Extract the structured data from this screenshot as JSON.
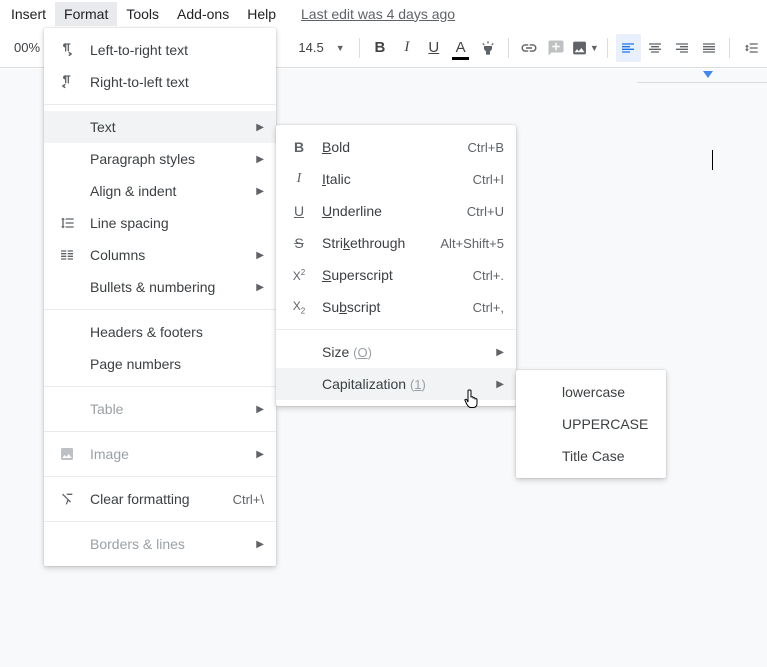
{
  "menubar": {
    "items": [
      "Insert",
      "Format",
      "Tools",
      "Add-ons",
      "Help"
    ],
    "active_index": 1,
    "last_edit": "Last edit was 4 days ago"
  },
  "toolbar": {
    "zoom": "00%",
    "font_size": "14.5"
  },
  "format_menu": {
    "items": [
      {
        "icon": "ltr",
        "label": "Left-to-right text"
      },
      {
        "icon": "rtl",
        "label": "Right-to-left text"
      },
      {
        "sep": true
      },
      {
        "label": "Text",
        "arrow": true,
        "hover": true
      },
      {
        "label": "Paragraph styles",
        "arrow": true
      },
      {
        "label": "Align & indent",
        "arrow": true
      },
      {
        "icon": "linespacing",
        "label": "Line spacing"
      },
      {
        "icon": "columns",
        "label": "Columns",
        "arrow": true
      },
      {
        "label": "Bullets & numbering",
        "arrow": true
      },
      {
        "sep": true
      },
      {
        "label": "Headers & footers"
      },
      {
        "label": "Page numbers"
      },
      {
        "sep": true
      },
      {
        "label": "Table",
        "arrow": true,
        "dim": true
      },
      {
        "sep": true
      },
      {
        "icon": "image",
        "label": "Image",
        "arrow": true,
        "dim": true
      },
      {
        "sep": true
      },
      {
        "icon": "clear",
        "label": "Clear formatting",
        "shortcut": "Ctrl+\\"
      },
      {
        "sep": true
      },
      {
        "label": "Borders & lines",
        "arrow": true,
        "dim": true
      }
    ]
  },
  "text_menu": {
    "items": [
      {
        "icon": "B",
        "label": "Bold",
        "u": 0,
        "shortcut": "Ctrl+B"
      },
      {
        "icon": "I",
        "label": "Italic",
        "u": 0,
        "shortcut": "Ctrl+I"
      },
      {
        "icon": "U",
        "label": "Underline",
        "u": 0,
        "shortcut": "Ctrl+U"
      },
      {
        "icon": "S",
        "label": "Strikethrough",
        "u": 4,
        "shortcut": "Alt+Shift+5"
      },
      {
        "icon": "X2",
        "label": "Superscript",
        "u": 0,
        "shortcut": "Ctrl+."
      },
      {
        "icon": "x2",
        "label": "Subscript",
        "u": 2,
        "shortcut": "Ctrl+,"
      },
      {
        "sep": true
      },
      {
        "label": "Size",
        "opt": "(O)",
        "u_opt": 1,
        "arrow": true
      },
      {
        "label": "Capitalization",
        "opt": "(1)",
        "u_opt": 1,
        "arrow": true,
        "hover": true
      }
    ]
  },
  "cap_menu": {
    "items": [
      {
        "label": "lowercase"
      },
      {
        "label": "UPPERCASE"
      },
      {
        "label": "Title Case"
      }
    ]
  }
}
